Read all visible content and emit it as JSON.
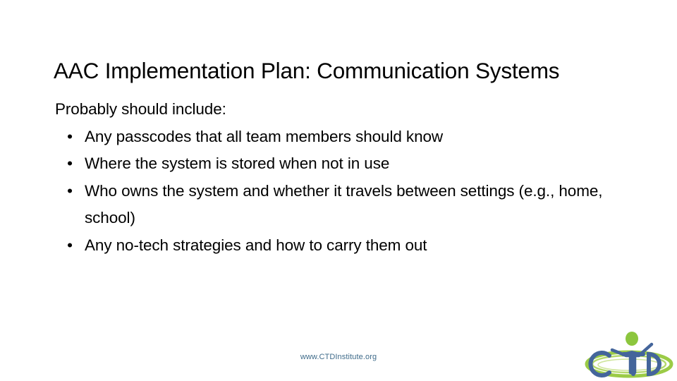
{
  "slide": {
    "title": "AAC Implementation Plan: Communication Systems",
    "intro": "Probably should include:",
    "bullets": [
      {
        "marker": "•",
        "text": "Any passcodes that all team members should know"
      },
      {
        "marker": "•",
        "text": "Where the system is stored when not in use"
      },
      {
        "marker": "•",
        "text": "Who owns the system and whether it travels between settings (e.g., home, school)"
      },
      {
        "marker": "•",
        "text": "Any no-tech strategies and how to carry them out"
      }
    ],
    "footer_url": "www.CTDInstitute.org",
    "logo": {
      "name": "ctd-institute-logo",
      "letters": "CTD",
      "letter_color": "#44659b",
      "accent_color": "#8cc63e",
      "swoosh_color": "#9bcb46"
    },
    "colors": {
      "background": "#ffffff",
      "text": "#000000",
      "footer_text": "#3f6b8a"
    }
  }
}
